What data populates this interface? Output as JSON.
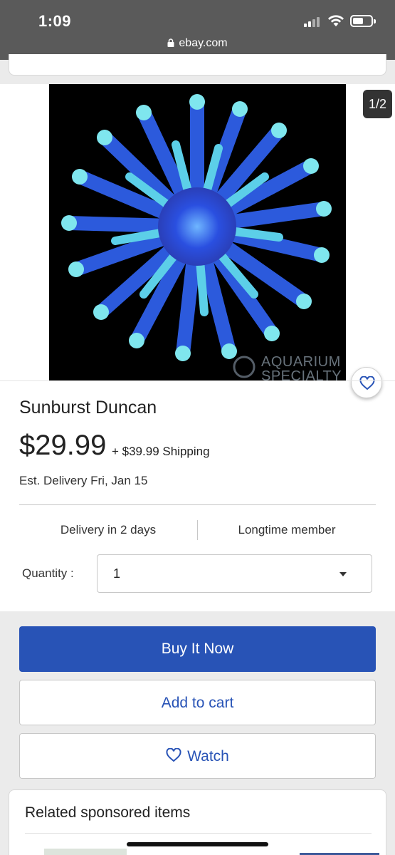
{
  "status_bar": {
    "time": "1:09",
    "url": "ebay.com",
    "icons": [
      "signal-icon",
      "wifi-icon",
      "battery-icon"
    ]
  },
  "gallery": {
    "counter": "1/2",
    "watermark": "AQUARIUM SPECIALTY LIVE",
    "accent_color": "#1fa3e8"
  },
  "product": {
    "title": "Sunburst Duncan",
    "price": "$29.99",
    "shipping": "+ $39.99 Shipping",
    "est_delivery": "Est. Delivery Fri, Jan 15"
  },
  "features": {
    "left": "Delivery in 2 days",
    "right": "Longtime member"
  },
  "quantity": {
    "label": "Quantity :",
    "value": "1"
  },
  "actions": {
    "buy_now": "Buy It Now",
    "add_to_cart": "Add to cart",
    "watch": "Watch",
    "primary_color": "#2853b6"
  },
  "related": {
    "heading": "Related sponsored items"
  }
}
